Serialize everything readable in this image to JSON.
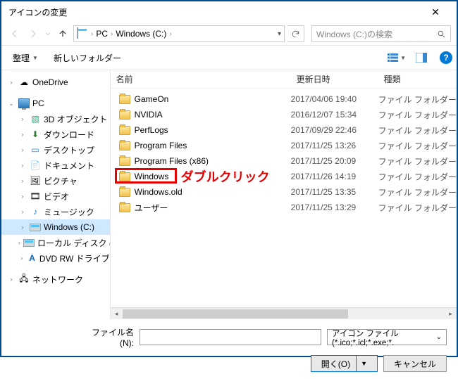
{
  "window": {
    "title": "アイコンの変更"
  },
  "breadcrumb": {
    "pc": "PC",
    "drive": "Windows (C:)"
  },
  "search": {
    "placeholder": "Windows (C:)の検索"
  },
  "toolbar": {
    "organize": "整理",
    "newfolder": "新しいフォルダー"
  },
  "columns": {
    "name": "名前",
    "date": "更新日時",
    "type": "種類"
  },
  "tree": {
    "onedrive": "OneDrive",
    "pc": "PC",
    "threed": "3D オブジェクト",
    "downloads": "ダウンロード",
    "desktop": "デスクトップ",
    "documents": "ドキュメント",
    "pictures": "ピクチャ",
    "videos": "ビデオ",
    "music": "ミュージック",
    "cdrive": "Windows (C:)",
    "localdisk": "ローカル ディスク (D",
    "dvd": "DVD RW ドライブ",
    "network": "ネットワーク"
  },
  "files": [
    {
      "name": "GameOn",
      "date": "2017/04/06 19:40",
      "type": "ファイル フォルダー"
    },
    {
      "name": "NVIDIA",
      "date": "2016/12/07 15:34",
      "type": "ファイル フォルダー"
    },
    {
      "name": "PerfLogs",
      "date": "2017/09/29 22:46",
      "type": "ファイル フォルダー"
    },
    {
      "name": "Program Files",
      "date": "2017/11/25 13:26",
      "type": "ファイル フォルダー"
    },
    {
      "name": "Program Files (x86)",
      "date": "2017/11/25 20:09",
      "type": "ファイル フォルダー"
    },
    {
      "name": "Windows",
      "date": "2017/11/26 14:19",
      "type": "ファイル フォルダー"
    },
    {
      "name": "Windows.old",
      "date": "2017/11/25 13:35",
      "type": "ファイル フォルダー"
    },
    {
      "name": "ユーザー",
      "date": "2017/11/25 13:29",
      "type": "ファイル フォルダー"
    }
  ],
  "footer": {
    "filename_label": "ファイル名(N):",
    "filter": "アイコン ファイル (*.ico;*.icl;*.exe;*.",
    "open": "開く(O)",
    "cancel": "キャンセル"
  },
  "annotation": "ダブルクリック"
}
